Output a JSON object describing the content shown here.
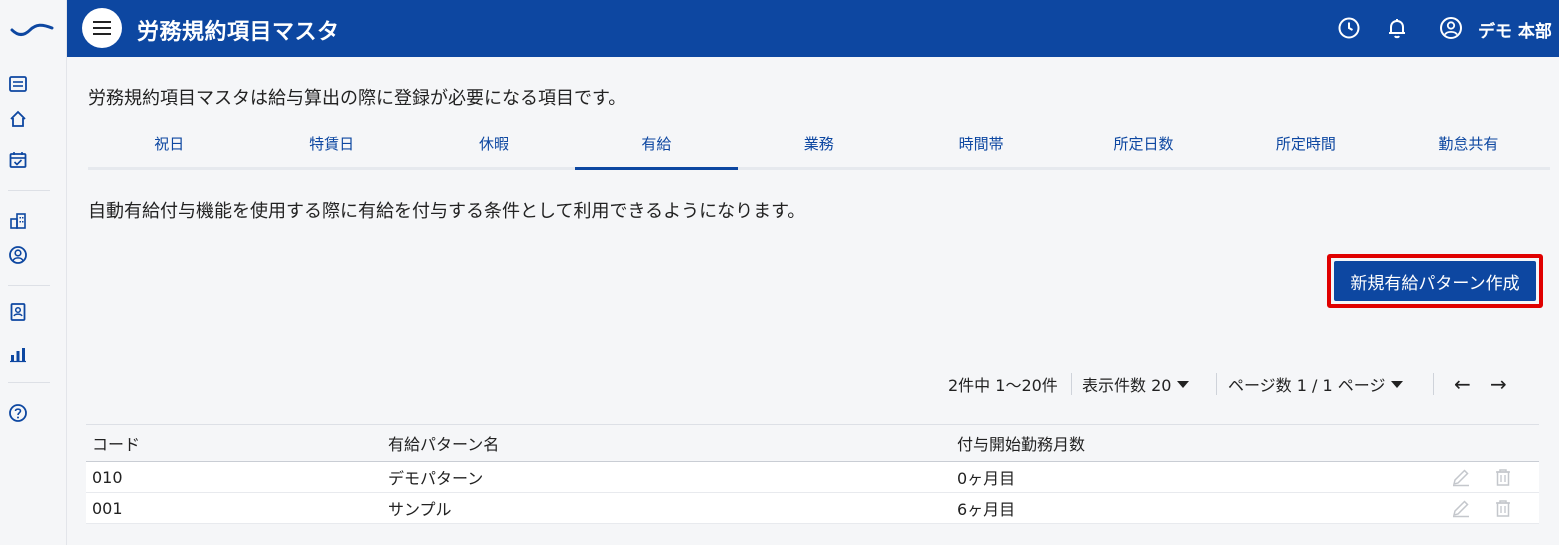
{
  "header": {
    "title": "労務規約項目マスタ",
    "user_name": "デモ 本部"
  },
  "description": "労務規約項目マスタは給与算出の際に登録が必要になる項目です。",
  "tabs": [
    {
      "label": "祝日",
      "active": false
    },
    {
      "label": "特賃日",
      "active": false
    },
    {
      "label": "休暇",
      "active": false
    },
    {
      "label": "有給",
      "active": true
    },
    {
      "label": "業務",
      "active": false
    },
    {
      "label": "時間帯",
      "active": false
    },
    {
      "label": "所定日数",
      "active": false
    },
    {
      "label": "所定時間",
      "active": false
    },
    {
      "label": "勤怠共有",
      "active": false
    }
  ],
  "sub_description": "自動有給付与機能を使用する際に有給を付与する条件として利用できるようになります。",
  "create_button": "新規有給パターン作成",
  "pagination": {
    "count_text": "2件中 1〜20件",
    "per_page_text": "表示件数 20",
    "page_text": "ページ数 1 / 1 ページ",
    "prev": "←",
    "next": "→"
  },
  "table": {
    "headers": [
      "コード",
      "有給パターン名",
      "付与開始勤務月数"
    ],
    "rows": [
      {
        "code": "010",
        "name": "デモパターン",
        "months": "0ヶ月目"
      },
      {
        "code": "001",
        "name": "サンプル",
        "months": "6ヶ月目"
      }
    ]
  },
  "colors": {
    "brand": "#0d47a1",
    "highlight": "#e00000"
  }
}
